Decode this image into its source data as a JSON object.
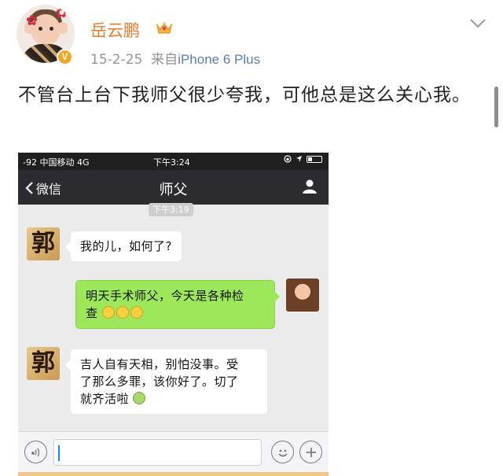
{
  "post": {
    "username": "岳云鹏",
    "date": "15-2-25",
    "source_prefix": "来自",
    "source_device": "iPhone 6 Plus",
    "text": "不管台上台下我师父很少夸我，可他总是这么关心我。",
    "verified_badge": "V"
  },
  "screenshot": {
    "status": {
      "carrier": "-92 中国移动  4G",
      "time": "下午3:24"
    },
    "nav": {
      "back_label": "微信",
      "title": "师父"
    },
    "timestamp": "下午3:19",
    "messages": [
      {
        "side": "left",
        "avatar_text": "郭",
        "text": "我的儿，如何了?"
      },
      {
        "side": "right",
        "text_line1": "明天手术师父，今天是各种检",
        "text_line2": "查"
      },
      {
        "side": "left",
        "avatar_text": "郭",
        "text_line1": "吉人自有天相，别怕没事。受",
        "text_line2": "了那么多罪，该你好了。切了",
        "text_line3": "就齐活啦"
      }
    ]
  },
  "colors": {
    "username": "#eb7b29",
    "source_link": "#5b7fad",
    "wechat_green": "#9de85a",
    "nav_bg": "#2c2c30"
  },
  "icons": [
    "chevron-down-icon",
    "crown-icon",
    "back-chevron-icon",
    "person-icon",
    "voice-icon",
    "emoji-icon",
    "plus-icon"
  ]
}
